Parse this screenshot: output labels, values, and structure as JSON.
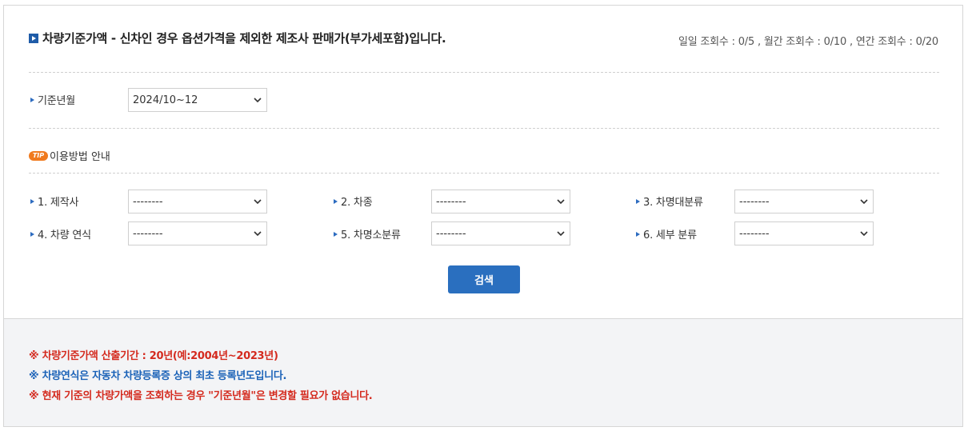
{
  "header": {
    "title": "차량기준가액 - 신차인 경우 옵션가격을 제외한 제조사 판매가(부가세포함)입니다.",
    "counts": "일일 조회수 : 0/5 , 월간 조회수 : 0/10 , 연간 조회수 : 0/20"
  },
  "base_month": {
    "label": "기준년월",
    "value": "2024/10~12"
  },
  "tip": {
    "badge": "TIP",
    "label": "이용방법 안내"
  },
  "filters": {
    "manufacturer": {
      "label": "1. 제작사",
      "value": "--------"
    },
    "car_type": {
      "label": "2. 차종",
      "value": "--------"
    },
    "model_major": {
      "label": "3. 차명대분류",
      "value": "--------"
    },
    "model_year": {
      "label": "4. 차량 연식",
      "value": "--------"
    },
    "model_minor": {
      "label": "5. 차명소분류",
      "value": "--------"
    },
    "detail": {
      "label": "6. 세부 분류",
      "value": "--------"
    }
  },
  "search_button": "검색",
  "notes": [
    "※ 차량기준가액 산출기간 : 20년(예:2004년~2023년)",
    "※ 차량연식은 자동차 차량등록증 상의 최초 등록년도입니다.",
    "※ 현재 기준의 차량가액을 조회하는 경우 \"기준년월\"은 변경할 필요가 없습니다."
  ],
  "colors": {
    "accent": "#2a6fbf",
    "note_red": "#d42a1e",
    "note_blue": "#1c63b8",
    "tip": "#f07a1e"
  }
}
